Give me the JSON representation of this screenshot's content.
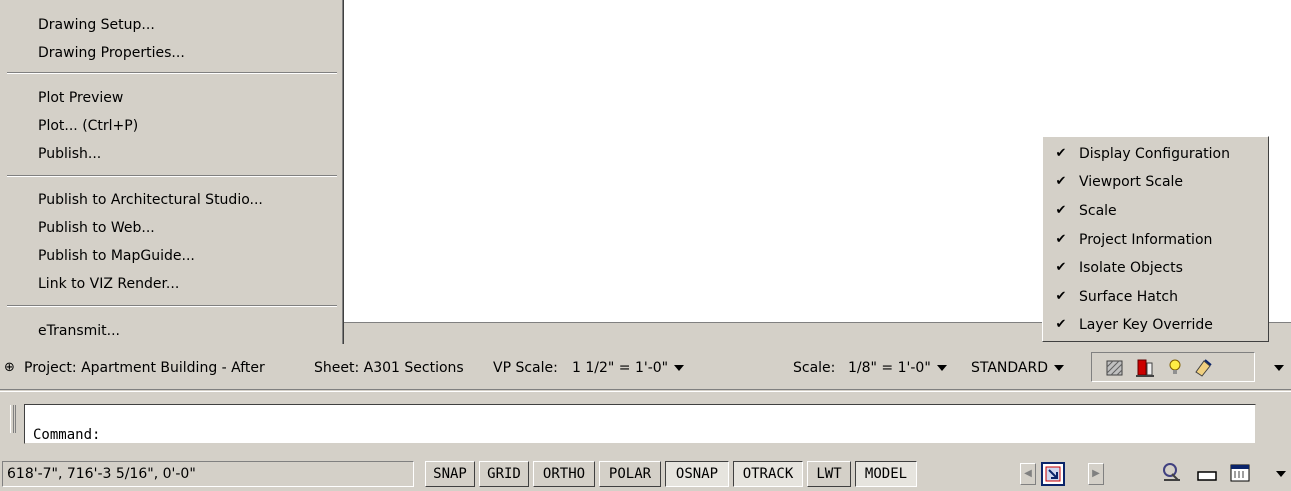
{
  "file_menu": {
    "items": [
      {
        "label": "Drawing Setup..."
      },
      {
        "label": "Drawing Properties..."
      },
      {
        "label": "Plot Preview"
      },
      {
        "label": "Plot... (Ctrl+P)"
      },
      {
        "label": "Publish..."
      },
      {
        "label": "Publish to Architectural Studio..."
      },
      {
        "label": "Publish to Web..."
      },
      {
        "label": "Publish to MapGuide..."
      },
      {
        "label": "Link to VIZ Render..."
      },
      {
        "label": "eTransmit..."
      }
    ]
  },
  "context_menu": {
    "items": [
      {
        "label": "Display Configuration",
        "checked": true
      },
      {
        "label": "Viewport Scale",
        "checked": true
      },
      {
        "label": "Scale",
        "checked": true
      },
      {
        "label": "Project Information",
        "checked": true
      },
      {
        "label": "Isolate Objects",
        "checked": true
      },
      {
        "label": "Surface Hatch",
        "checked": true
      },
      {
        "label": "Layer Key Override",
        "checked": true
      }
    ],
    "check_glyph": "✔"
  },
  "drawing_status": {
    "project_icon": "project-marker-icon",
    "project_glyph": "⊕",
    "project": "Project: Apartment Building - After",
    "sheet": "Sheet: A301 Sections",
    "vp_scale_label": "VP Scale:",
    "vp_scale_value": "1 1/2\" = 1'-0\"",
    "scale_label": "Scale:",
    "scale_value": "1/8\" = 1'-0\"",
    "display_config": "STANDARD",
    "tray_icons": [
      "surface-hatch-icon",
      "isolate-objects-icon",
      "lightbulb-icon",
      "layer-key-icon"
    ]
  },
  "command": {
    "prompt": "Command:"
  },
  "app_status": {
    "coordinates": "618'-7\",    716'-3 5/16\", 0'-0\"",
    "modes": [
      {
        "label": "SNAP",
        "on": false
      },
      {
        "label": "GRID",
        "on": false
      },
      {
        "label": "ORTHO",
        "on": false
      },
      {
        "label": "POLAR",
        "on": false
      },
      {
        "label": "OSNAP",
        "on": true
      },
      {
        "label": "OTRACK",
        "on": true
      },
      {
        "label": "LWT",
        "on": false
      },
      {
        "label": "MODEL",
        "on": true
      }
    ],
    "tray_icons": [
      "maximize-viewport-icon",
      "communication-center-icon",
      "window-icon",
      "toolbar-lock-icon"
    ]
  },
  "colors": {
    "face": "#d4d0c8",
    "canvas": "#ffffff",
    "accent_blue": "#0a246a",
    "check": "#000000"
  }
}
